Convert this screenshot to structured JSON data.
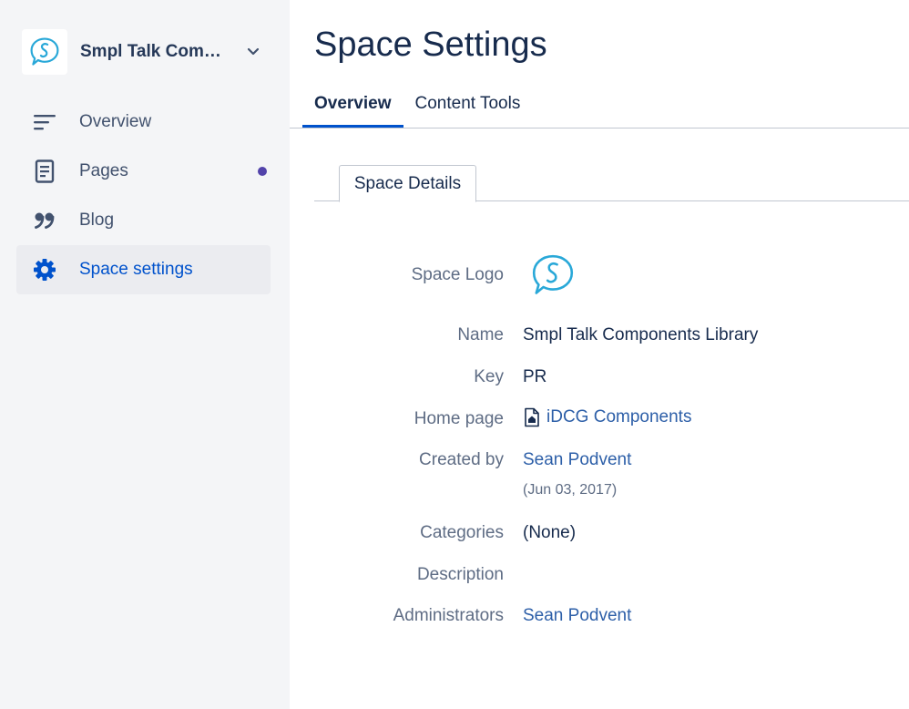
{
  "sidebar": {
    "space_name": "Smpl Talk Components Library",
    "items": [
      {
        "label": "Overview",
        "icon": "overview-lines-icon"
      },
      {
        "label": "Pages",
        "icon": "page-icon",
        "has_dot": true
      },
      {
        "label": "Blog",
        "icon": "quote-icon"
      },
      {
        "label": "Space settings",
        "icon": "gear-icon",
        "active": true
      }
    ]
  },
  "main": {
    "title": "Space Settings",
    "tabs": [
      {
        "label": "Overview",
        "active": true
      },
      {
        "label": "Content Tools",
        "active": false
      }
    ],
    "subtab": "Space Details"
  },
  "details": {
    "logo_label": "Space Logo",
    "name_label": "Name",
    "name_value": "Smpl Talk Components Library",
    "key_label": "Key",
    "key_value": "PR",
    "home_label": "Home page",
    "home_value": "iDCG Components",
    "created_label": "Created by",
    "created_value": "Sean Podvent",
    "created_date": "(Jun 03, 2017)",
    "categories_label": "Categories",
    "categories_value": "(None)",
    "description_label": "Description",
    "admins_label": "Administrators",
    "admins_value": "Sean Podvent"
  },
  "colors": {
    "sidebar_bg": "#f4f5f7",
    "active_blue": "#0052cc",
    "link_blue": "#2d5fa8",
    "logo_teal": "#29a8d8",
    "notification_dot": "#5243aa"
  }
}
